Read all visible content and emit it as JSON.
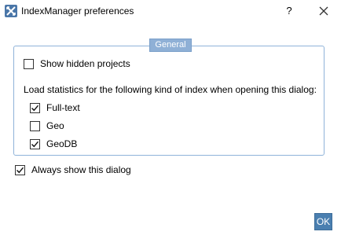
{
  "window": {
    "title": "IndexManager preferences",
    "help_label": "?",
    "close_icon": "close-icon"
  },
  "group": {
    "title": "General",
    "show_hidden_projects": {
      "label": "Show hidden projects",
      "checked": false
    },
    "load_stats_label": "Load statistics for the following kind of index when opening this dialog:",
    "index_kinds": [
      {
        "label": "Full-text",
        "checked": true
      },
      {
        "label": "Geo",
        "checked": false
      },
      {
        "label": "GeoDB",
        "checked": true
      }
    ]
  },
  "always_show": {
    "label": "Always show this dialog",
    "checked": true
  },
  "buttons": {
    "ok_label": "OK"
  },
  "colors": {
    "accent": "#4a7fb0",
    "group_border": "#8fb3d9",
    "group_title_bg": "#8fb0d6"
  }
}
